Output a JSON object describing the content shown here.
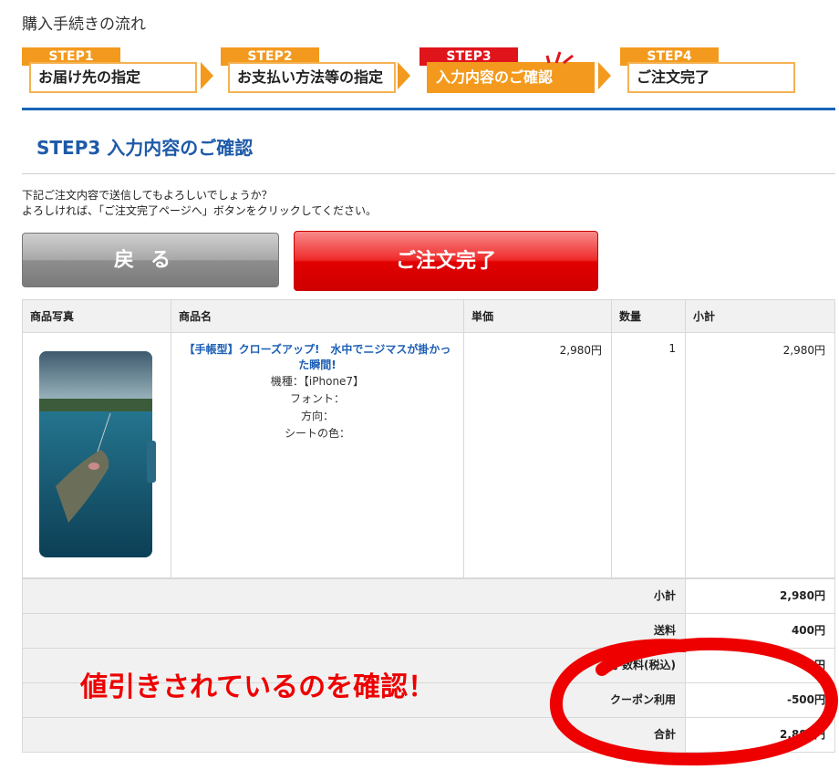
{
  "page": {
    "heading": "購入手続きの流れ"
  },
  "steps": [
    {
      "tag": "STEP1",
      "label": "お届け先の指定",
      "active": false
    },
    {
      "tag": "STEP2",
      "label": "お支払い方法等の指定",
      "active": false
    },
    {
      "tag": "STEP3",
      "label": "入力内容のご確認",
      "active": true
    },
    {
      "tag": "STEP4",
      "label": "ご注文完了",
      "active": false
    }
  ],
  "section": {
    "title": "STEP3 入力内容のご確認",
    "instruction_line1": "下記ご注文内容で送信してもよろしいでしょうか？",
    "instruction_line2": "よろしければ、「ご注文完了ページへ」ボタンをクリックしてください。"
  },
  "buttons": {
    "back": "戻る",
    "order": "ご注文完了"
  },
  "table": {
    "headers": [
      "商品写真",
      "商品名",
      "単価",
      "数量",
      "小計"
    ],
    "product": {
      "name": "【手帳型】クローズアップ!　水中でニジマスが掛かった瞬間!",
      "model_label": "機種：【iPhone7】",
      "font_label": "フォント：",
      "direction_label": "方向：",
      "sheet_color_label": "シートの色：",
      "unit_price": "2,980円",
      "quantity": "1",
      "subtotal": "2,980円"
    },
    "summary": [
      {
        "label": "小計",
        "value": "2,980円"
      },
      {
        "label": "送料",
        "value": "400円"
      },
      {
        "label": "手数料(税込)",
        "value": "0円"
      },
      {
        "label": "クーポン利用",
        "value": "-500円"
      },
      {
        "label": "合計",
        "value": "2,880円"
      }
    ]
  },
  "annotation": {
    "text": "値引きされているのを確認！"
  },
  "colors": {
    "accent_orange": "#f39a1e",
    "accent_red": "#e10000",
    "title_blue": "#1e5aa8"
  }
}
